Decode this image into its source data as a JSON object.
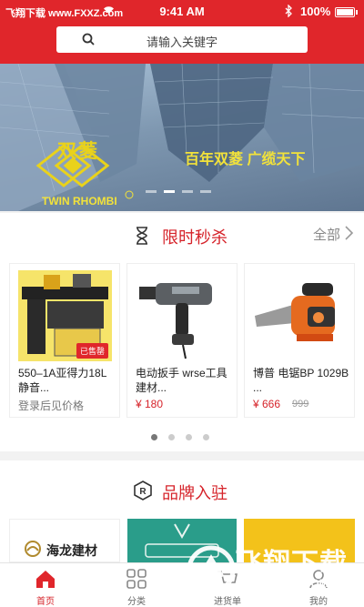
{
  "status_bar": {
    "carrier": "飞翔下载 www.FXXZ.com",
    "time": "9:41 AM",
    "battery": "100%"
  },
  "search": {
    "placeholder": "请输入关键字"
  },
  "banner": {
    "brand_cn": "双菱",
    "brand_en": "TWIN RHOMBI",
    "slogan": "百年双菱 广缆天下",
    "slides": 4,
    "active_slide": 2
  },
  "flash_sale": {
    "title": "限时秒杀",
    "more": "全部",
    "products": [
      {
        "name": "550–1A亚得力18L静音...",
        "price": "登录后见价格",
        "tag": "已售罄",
        "old_price": ""
      },
      {
        "name": "电动扳手 wrse工具建材...",
        "price": "¥ 180",
        "tag": "",
        "old_price": ""
      },
      {
        "name": "博普 电锯BP 1029B ...",
        "price": "¥ 666",
        "tag": "",
        "old_price": "999"
      }
    ],
    "pages": 4,
    "active_page": 1
  },
  "brands": {
    "title": "品牌入驻",
    "items": [
      {
        "name": "海龙建材"
      },
      {
        "name": ""
      },
      {
        "name": ""
      }
    ]
  },
  "tabs": [
    {
      "label": "首页",
      "active": true
    },
    {
      "label": "分类",
      "active": false
    },
    {
      "label": "进货单",
      "active": false
    },
    {
      "label": "我的",
      "active": false
    }
  ],
  "watermark": {
    "text": "飞翔下载",
    "url": "WWW.FXXZ.COM"
  },
  "colors": {
    "brand_red": "#e0262b",
    "price_red": "#d6232a",
    "banner_gold": "#e9d21b"
  }
}
